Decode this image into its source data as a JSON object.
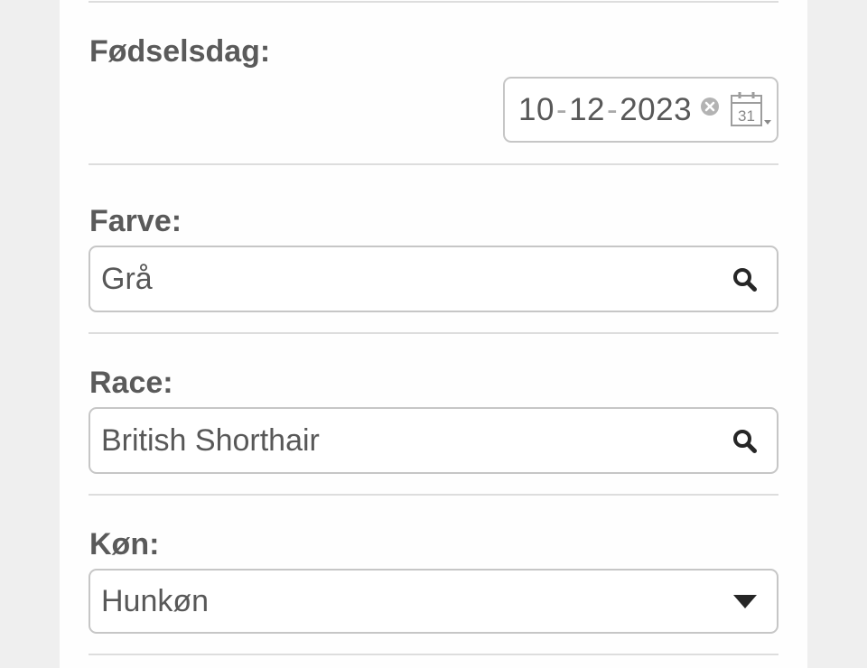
{
  "form": {
    "birthday": {
      "label": "Fødselsdag:",
      "day": "10",
      "month": "12",
      "year": "2023",
      "separator": "-",
      "calendar_day": "31",
      "clear_icon": "clear-circle-icon",
      "calendar_icon": "calendar-icon"
    },
    "color": {
      "label": "Farve:",
      "value": "Grå",
      "icon": "search-icon"
    },
    "breed": {
      "label": "Race:",
      "value": "British Shorthair",
      "icon": "search-icon"
    },
    "gender": {
      "label": "Køn:",
      "value": "Hunkøn",
      "icon": "caret-down-icon"
    }
  },
  "colors": {
    "background": "#efefef",
    "card": "#fefefe",
    "divider": "#dddddd",
    "field_border": "#c6c6c6",
    "label_text": "#5a5a5a",
    "value_text": "#585858"
  }
}
